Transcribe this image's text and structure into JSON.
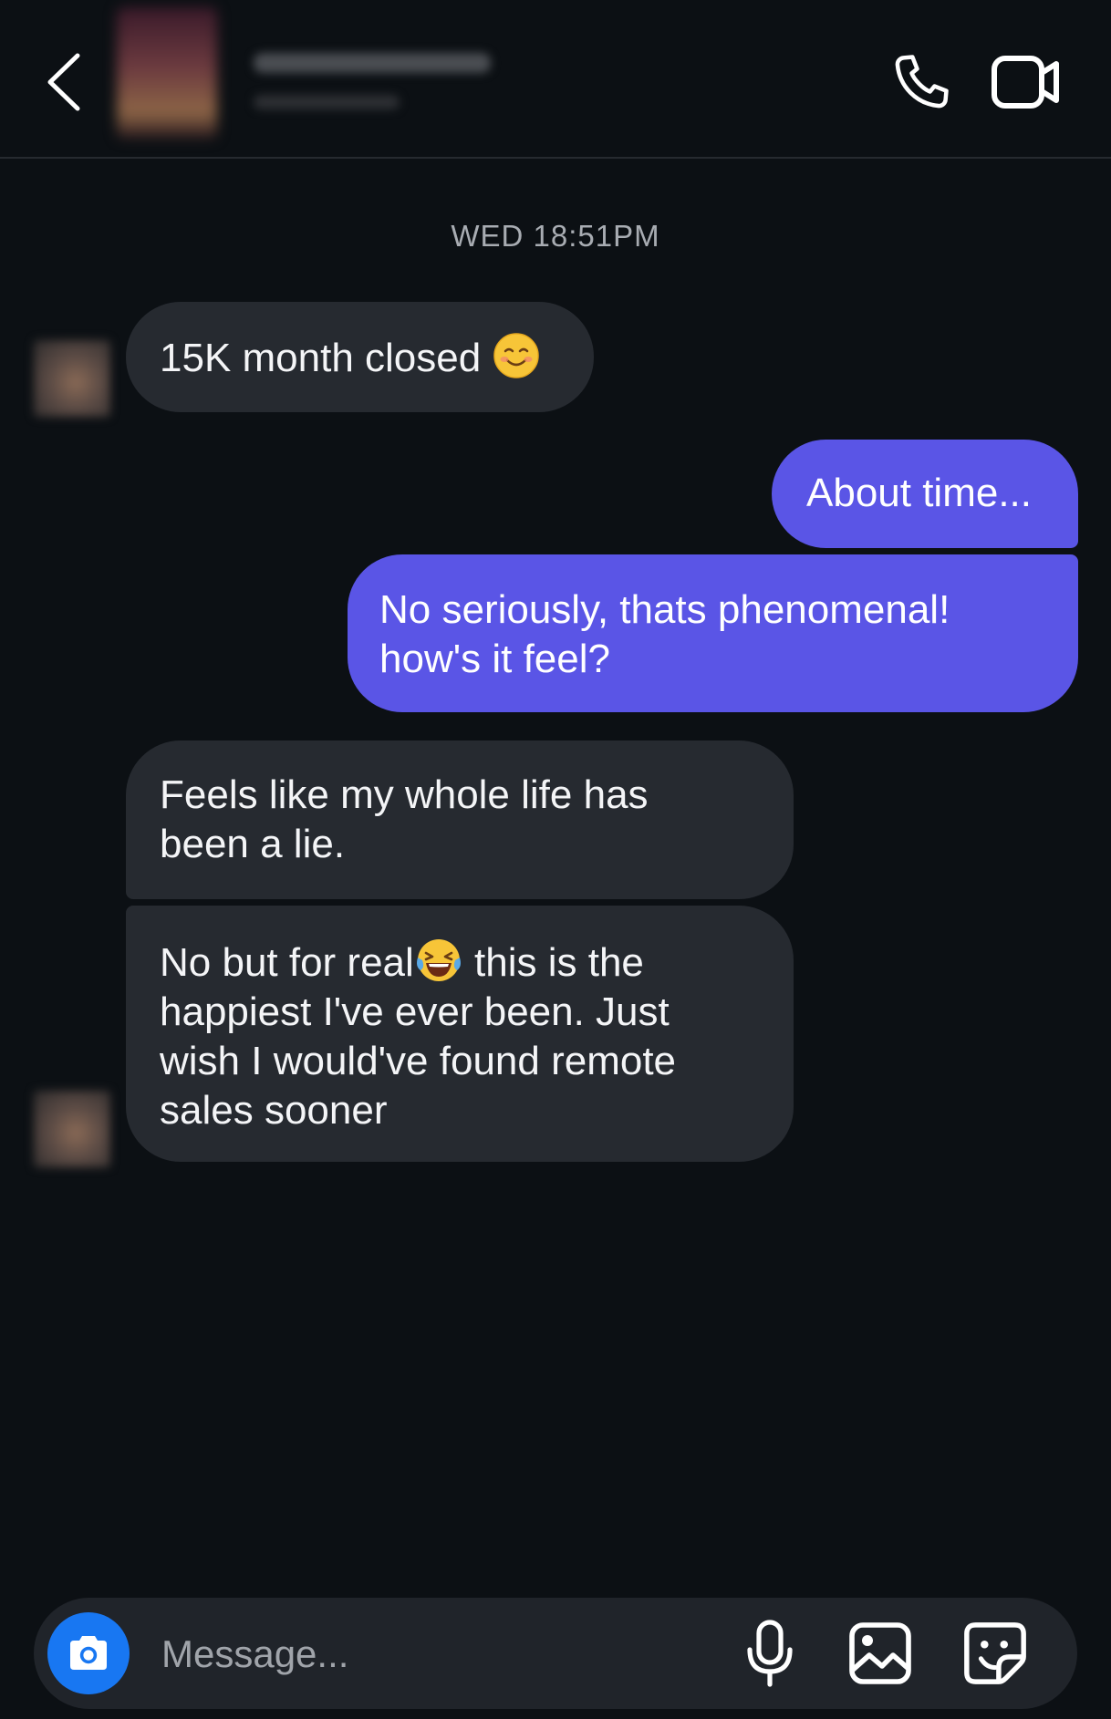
{
  "header": {
    "back_icon": "chevron-left-icon",
    "call_icon": "phone-icon",
    "video_icon": "video-camera-icon"
  },
  "timestamp": "WED 18:51PM",
  "messages": [
    {
      "from": "them",
      "text": "15K month closed ",
      "emoji": "smiling-face-icon"
    },
    {
      "from": "me",
      "text": "About time..."
    },
    {
      "from": "me",
      "text": "No seriously, thats phenomenal!\nhow's it feel?"
    },
    {
      "from": "them",
      "text": "Feels like my whole life has\nbeen a lie."
    },
    {
      "from": "them",
      "text_before": "No but for real",
      "emoji": "laughing-tears-icon",
      "text_after": " this is the\nhappiest I've ever been. Just\nwish I would've found remote\nsales sooner"
    }
  ],
  "composer": {
    "placeholder": "Message...",
    "value": ""
  },
  "colors": {
    "background": "#0c1014",
    "incoming_bubble": "#262a30",
    "outgoing_bubble": "#5a55e6",
    "camera_button": "#1877f2"
  }
}
